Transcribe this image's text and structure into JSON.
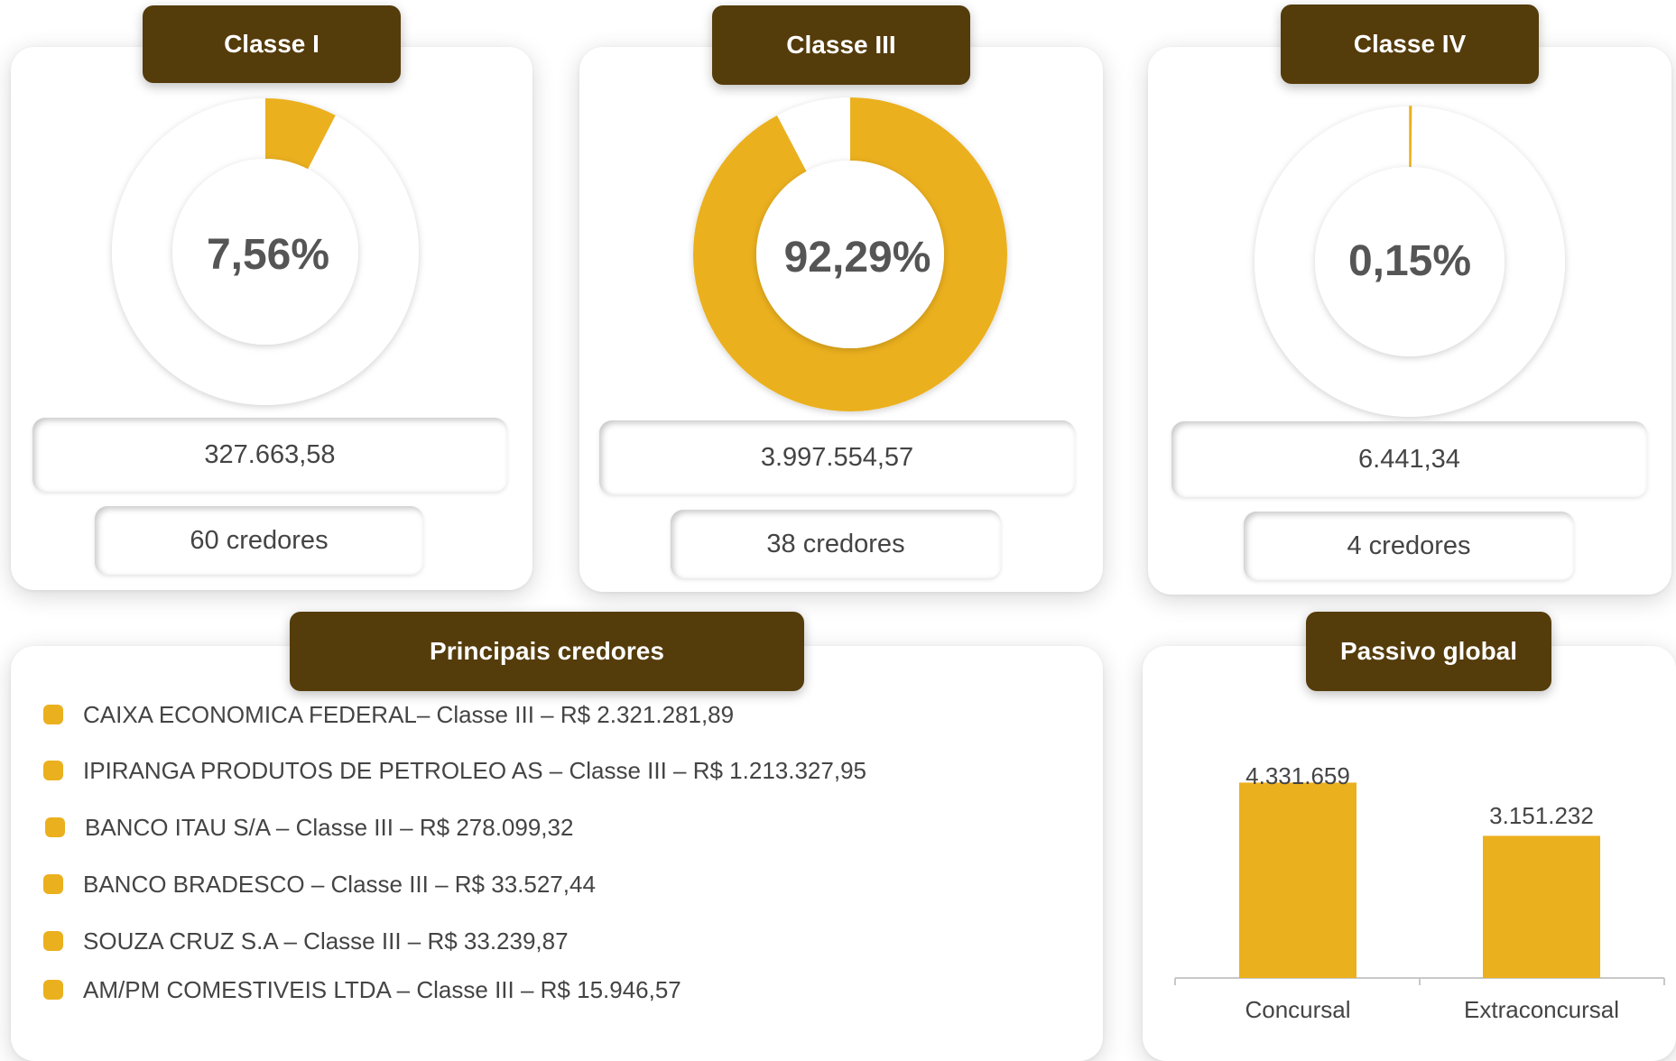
{
  "classes": [
    {
      "header": "Classe I",
      "percent_label": "7,56%",
      "percent": 7.56,
      "amount": "327.663,58",
      "creditors": "60 credores"
    },
    {
      "header": "Classe III",
      "percent_label": "92,29%",
      "percent": 92.29,
      "amount": "3.997.554,57",
      "creditors": "38 credores"
    },
    {
      "header": "Classe IV",
      "percent_label": "0,15%",
      "percent": 0.15,
      "amount": "6.441,34",
      "creditors": "4 credores"
    }
  ],
  "principais": {
    "header": "Principais credores",
    "items": [
      "CAIXA ECONOMICA FEDERAL– Classe III – R$ 2.321.281,89",
      "IPIRANGA PRODUTOS DE PETROLEO AS – Classe III – R$ 1.213.327,95",
      "BANCO ITAU S/A – Classe III – R$ 278.099,32",
      "BANCO BRADESCO – Classe III – R$ 33.527,44",
      "SOUZA CRUZ S.A – Classe III – R$ 33.239,87",
      "AM/PM COMESTIVEIS LTDA – Classe III – R$ 15.946,57"
    ]
  },
  "passivo": {
    "header": "Passivo global"
  },
  "colors": {
    "accent": "#ebb01e",
    "header_bg": "#553c0b",
    "track": "#ffffff"
  },
  "chart_data": [
    {
      "type": "pie",
      "title": "Classe I",
      "values": [
        7.56,
        92.44
      ],
      "center_label": "7,56%"
    },
    {
      "type": "pie",
      "title": "Classe III",
      "values": [
        92.29,
        7.71
      ],
      "center_label": "92,29%"
    },
    {
      "type": "pie",
      "title": "Classe IV",
      "values": [
        0.15,
        99.85
      ],
      "center_label": "0,15%"
    },
    {
      "type": "bar",
      "title": "Passivo global",
      "categories": [
        "Concursal",
        "Extraconcursal"
      ],
      "values": [
        4331659,
        3151232
      ],
      "value_labels": [
        "4.331.659",
        "3.151.232"
      ],
      "ylim": [
        0,
        5000000
      ]
    }
  ]
}
